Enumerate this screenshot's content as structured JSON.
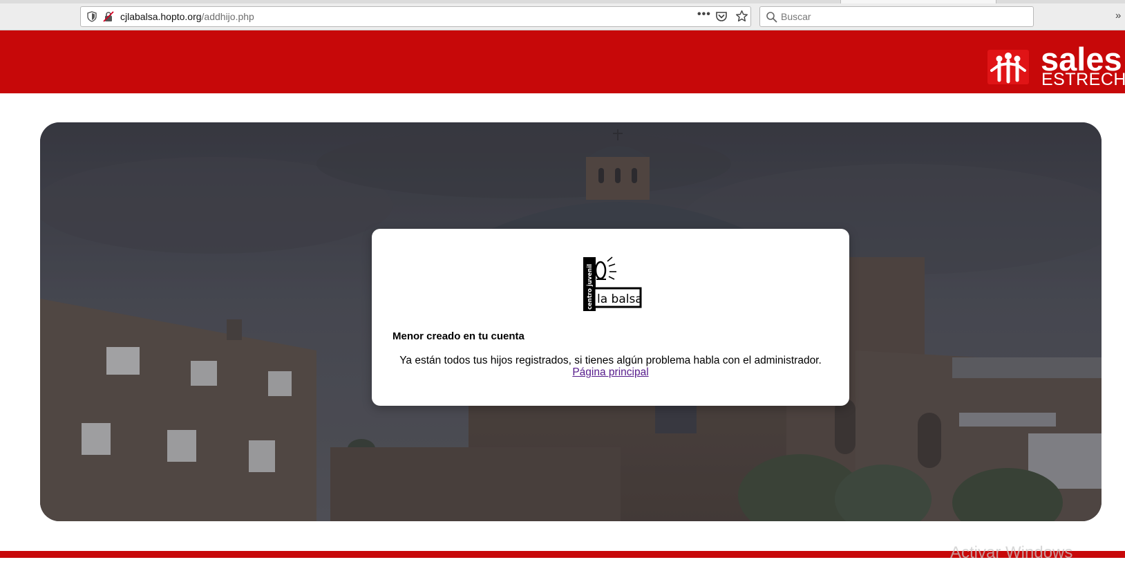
{
  "browser": {
    "url_host": "cjlabalsa.hopto.org",
    "url_path": "/addhijo.php",
    "search_placeholder": "Buscar"
  },
  "header": {
    "brand_name": "sales",
    "brand_sub": "ESTRECHO"
  },
  "logo": {
    "vertical_text": "centro juvenil",
    "main_text": "la balsa"
  },
  "card": {
    "title": "Menor creado en tu cuenta",
    "message": "Ya están todos tus hijos registrados, si tienes algún problema habla con el administrador.",
    "link_label": "Página principal"
  },
  "watermark": "Activar Windows",
  "colors": {
    "brand_red": "#c70809",
    "visited_link": "#551a8b"
  },
  "icons": [
    "shield-icon",
    "insecure-lock-icon",
    "more-icon",
    "pocket-icon",
    "bookmark-star-icon",
    "search-icon",
    "salesianos-emblem-icon"
  ]
}
